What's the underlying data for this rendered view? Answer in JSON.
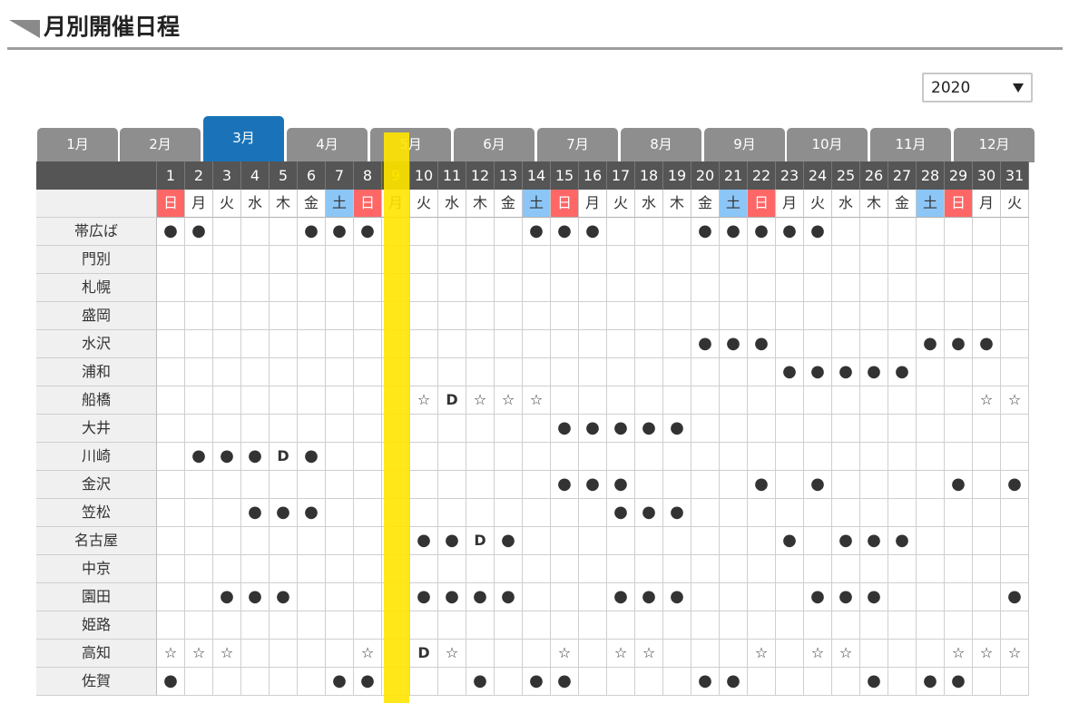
{
  "header": {
    "title": "月別開催日程"
  },
  "year_select": {
    "value": "2020"
  },
  "months": [
    "1月",
    "2月",
    "3月",
    "4月",
    "5月",
    "6月",
    "7月",
    "8月",
    "9月",
    "10月",
    "11月",
    "12月"
  ],
  "active_month_index": 2,
  "days": [
    "1",
    "2",
    "3",
    "4",
    "5",
    "6",
    "7",
    "8",
    "9",
    "10",
    "11",
    "12",
    "13",
    "14",
    "15",
    "16",
    "17",
    "18",
    "19",
    "20",
    "21",
    "22",
    "23",
    "24",
    "25",
    "26",
    "27",
    "28",
    "29",
    "30",
    "31"
  ],
  "highlight_day_index": 8,
  "weekdays": [
    "日",
    "月",
    "火",
    "水",
    "木",
    "金",
    "土",
    "日",
    "月",
    "火",
    "水",
    "木",
    "金",
    "土",
    "日",
    "月",
    "火",
    "水",
    "木",
    "金",
    "土",
    "日",
    "月",
    "火",
    "水",
    "木",
    "金",
    "土",
    "日",
    "月",
    "火"
  ],
  "rows": [
    {
      "label": "帯広ば",
      "cells": [
        "●",
        "●",
        "",
        "",
        "",
        "●",
        "●",
        "●",
        "",
        "",
        "",
        "",
        "",
        "●",
        "●",
        "●",
        "",
        "",
        "",
        "●",
        "●",
        "●",
        "●",
        "●",
        "",
        "",
        "",
        "",
        "",
        "",
        ""
      ]
    },
    {
      "label": "門別",
      "cells": [
        "",
        "",
        "",
        "",
        "",
        "",
        "",
        "",
        "",
        "",
        "",
        "",
        "",
        "",
        "",
        "",
        "",
        "",
        "",
        "",
        "",
        "",
        "",
        "",
        "",
        "",
        "",
        "",
        "",
        "",
        ""
      ]
    },
    {
      "label": "札幌",
      "cells": [
        "",
        "",
        "",
        "",
        "",
        "",
        "",
        "",
        "",
        "",
        "",
        "",
        "",
        "",
        "",
        "",
        "",
        "",
        "",
        "",
        "",
        "",
        "",
        "",
        "",
        "",
        "",
        "",
        "",
        "",
        ""
      ]
    },
    {
      "label": "盛岡",
      "cells": [
        "",
        "",
        "",
        "",
        "",
        "",
        "",
        "",
        "",
        "",
        "",
        "",
        "",
        "",
        "",
        "",
        "",
        "",
        "",
        "",
        "",
        "",
        "",
        "",
        "",
        "",
        "",
        "",
        "",
        "",
        ""
      ]
    },
    {
      "label": "水沢",
      "cells": [
        "",
        "",
        "",
        "",
        "",
        "",
        "",
        "",
        "",
        "",
        "",
        "",
        "",
        "",
        "",
        "",
        "",
        "",
        "",
        "●",
        "●",
        "●",
        "",
        "",
        "",
        "",
        "",
        "●",
        "●",
        "●",
        ""
      ]
    },
    {
      "label": "浦和",
      "cells": [
        "",
        "",
        "",
        "",
        "",
        "",
        "",
        "",
        "",
        "",
        "",
        "",
        "",
        "",
        "",
        "",
        "",
        "",
        "",
        "",
        "",
        "",
        "●",
        "●",
        "●",
        "●",
        "●",
        "",
        "",
        "",
        ""
      ]
    },
    {
      "label": "船橋",
      "cells": [
        "",
        "",
        "",
        "",
        "",
        "",
        "",
        "",
        "",
        "☆",
        "D",
        "☆",
        "☆",
        "☆",
        "",
        "",
        "",
        "",
        "",
        "",
        "",
        "",
        "",
        "",
        "",
        "",
        "",
        "",
        "",
        "☆",
        "☆"
      ]
    },
    {
      "label": "大井",
      "cells": [
        "",
        "",
        "",
        "",
        "",
        "",
        "",
        "",
        "",
        "",
        "",
        "",
        "",
        "",
        "●",
        "●",
        "●",
        "●",
        "●",
        "",
        "",
        "",
        "",
        "",
        "",
        "",
        "",
        "",
        "",
        "",
        ""
      ]
    },
    {
      "label": "川崎",
      "cells": [
        "",
        "●",
        "●",
        "●",
        "D",
        "●",
        "",
        "",
        "",
        "",
        "",
        "",
        "",
        "",
        "",
        "",
        "",
        "",
        "",
        "",
        "",
        "",
        "",
        "",
        "",
        "",
        "",
        "",
        "",
        "",
        ""
      ]
    },
    {
      "label": "金沢",
      "cells": [
        "",
        "",
        "",
        "",
        "",
        "",
        "",
        "",
        "",
        "",
        "",
        "",
        "",
        "",
        "●",
        "●",
        "●",
        "",
        "",
        "",
        "",
        "●",
        "",
        "●",
        "",
        "",
        "",
        "",
        "●",
        "",
        "●"
      ]
    },
    {
      "label": "笠松",
      "cells": [
        "",
        "",
        "",
        "●",
        "●",
        "●",
        "",
        "",
        "",
        "",
        "",
        "",
        "",
        "",
        "",
        "",
        "●",
        "●",
        "●",
        "",
        "",
        "",
        "",
        "",
        "",
        "",
        "",
        "",
        "",
        "",
        ""
      ]
    },
    {
      "label": "名古屋",
      "cells": [
        "",
        "",
        "",
        "",
        "",
        "",
        "",
        "",
        "",
        "●",
        "●",
        "D",
        "●",
        "",
        "",
        "",
        "",
        "",
        "",
        "",
        "",
        "",
        "●",
        "",
        "●",
        "●",
        "●",
        "",
        "",
        "",
        ""
      ]
    },
    {
      "label": "中京",
      "cells": [
        "",
        "",
        "",
        "",
        "",
        "",
        "",
        "",
        "",
        "",
        "",
        "",
        "",
        "",
        "",
        "",
        "",
        "",
        "",
        "",
        "",
        "",
        "",
        "",
        "",
        "",
        "",
        "",
        "",
        "",
        ""
      ]
    },
    {
      "label": "園田",
      "cells": [
        "",
        "",
        "●",
        "●",
        "●",
        "",
        "",
        "",
        "",
        "●",
        "●",
        "●",
        "●",
        "",
        "",
        "",
        "●",
        "●",
        "●",
        "",
        "",
        "",
        "",
        "●",
        "●",
        "●",
        "",
        "",
        "",
        "",
        "●"
      ]
    },
    {
      "label": "姫路",
      "cells": [
        "",
        "",
        "",
        "",
        "",
        "",
        "",
        "",
        "",
        "",
        "",
        "",
        "",
        "",
        "",
        "",
        "",
        "",
        "",
        "",
        "",
        "",
        "",
        "",
        "",
        "",
        "",
        "",
        "",
        "",
        ""
      ]
    },
    {
      "label": "高知",
      "cells": [
        "☆",
        "☆",
        "☆",
        "",
        "",
        "",
        "",
        "☆",
        "",
        "D",
        "☆",
        "",
        "",
        "",
        "☆",
        "",
        "☆",
        "☆",
        "",
        "",
        "",
        "☆",
        "",
        "☆",
        "☆",
        "",
        "",
        "",
        "☆",
        "☆",
        "☆"
      ]
    },
    {
      "label": "佐賀",
      "cells": [
        "●",
        "",
        "",
        "",
        "",
        "",
        "●",
        "●",
        "",
        "",
        "",
        "●",
        "",
        "●",
        "●",
        "",
        "",
        "",
        "",
        "●",
        "●",
        "",
        "",
        "",
        "",
        "●",
        "",
        "●",
        "●",
        "",
        ""
      ]
    }
  ]
}
